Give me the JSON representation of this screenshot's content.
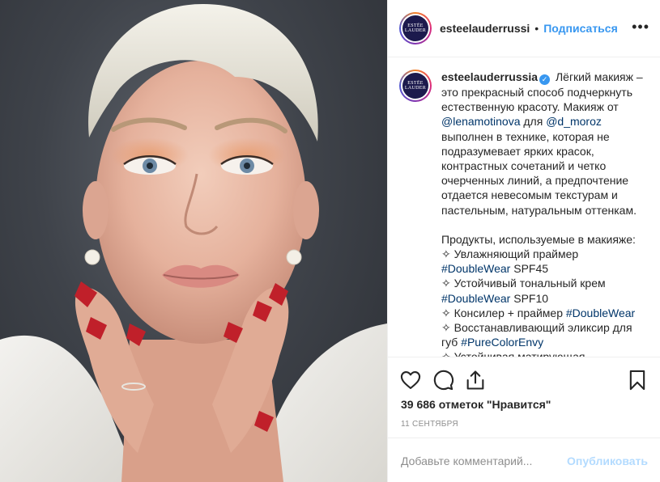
{
  "post": {
    "image_alt": "Portrait of a woman with short platinum hair, hands framing her face, red nails, white jacket",
    "header": {
      "username": "esteelauderrussi",
      "separator": "•",
      "follow_label": "Подписаться",
      "more_icon": "more-horizontal-icon"
    },
    "avatar": {
      "line1": "ESTĒE",
      "line2": "LAUDER",
      "bg": "#1c1a4d"
    },
    "caption": {
      "username": "esteelauderrussia",
      "p1_a": "Лёгкий макияж – это прекрасный способ подчеркнуть естественную красоту. Макияж от",
      "mention1": "@lenamotinova",
      "p1_b": "для",
      "mention2": "@d_moroz",
      "p1_c": "выполнен в технике, которая не подразумевает ярких красок, контрастных сочетаний и четко очерченных линий, а предпочтение отдается невесомым текстурам и пастельным, натуральным оттенкам.",
      "products_title": "Продукты, используемые в макияже:",
      "item1_text": "✧ Увлажняющий праймер",
      "item1_tag": "#DoubleWear",
      "item1_suffix": "SPF45",
      "item2_text": "✧ Устойчивый тональный крем",
      "item2_tag": "#DoubleWear",
      "item2_suffix": "SPF10",
      "item3_text": "✧ Консилер + праймер",
      "item3_tag": "#DoubleWear",
      "item4_text": "✧ Восстанавливающий эликсир для губ",
      "item4_tag": "#PureColorEnvy",
      "item5_text": "✧ Устойчивая матирующая"
    },
    "actions": {
      "like_icon": "heart-icon",
      "comment_icon": "comment-icon",
      "share_icon": "share-icon",
      "save_icon": "bookmark-icon"
    },
    "likes_text": "39 686 отметок \"Нравится\"",
    "date_text": "11 СЕНТЯБРЯ",
    "comment": {
      "placeholder": "Добавьте комментарий...",
      "publish_label": "Опубликовать"
    },
    "colors": {
      "link": "#003569",
      "follow": "#3897f0",
      "publish_disabled": "#b3dbff",
      "muted": "#8e8e8e",
      "border": "#efefef"
    }
  }
}
